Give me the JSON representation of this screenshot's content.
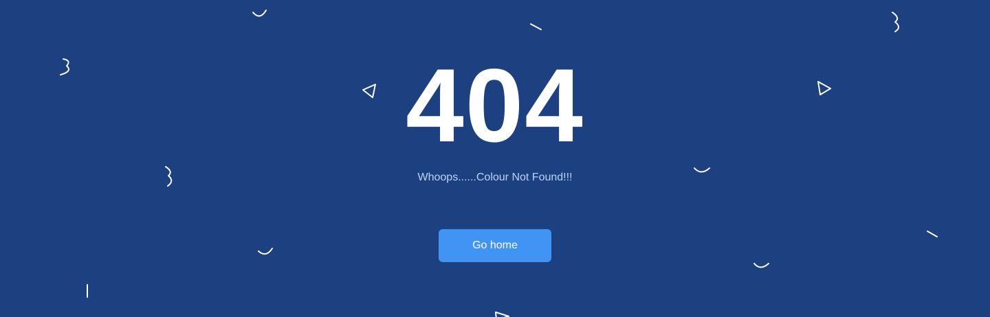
{
  "error": {
    "code": "404",
    "message": "Whoops......Colour Not Found!!!"
  },
  "actions": {
    "home_label": "Go home"
  },
  "colors": {
    "background": "#1c4080",
    "button": "#4294f4",
    "message_text": "#b9d6ff",
    "heading_text": "#ffffff"
  },
  "decorations": [
    "smile-curve-icon",
    "squiggle-3-icon",
    "triangle-outline-icon",
    "dash-line-icon"
  ]
}
